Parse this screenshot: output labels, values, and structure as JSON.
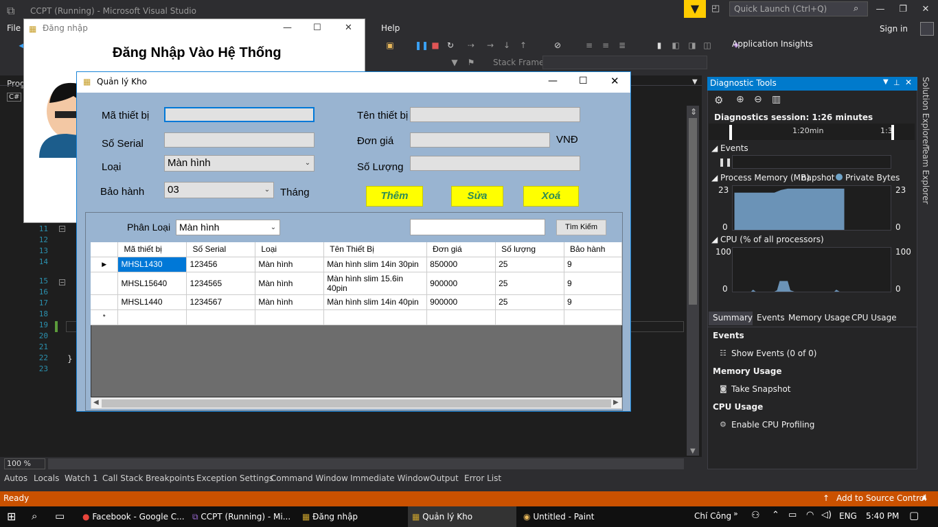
{
  "vs": {
    "title": "CCPT (Running) - Microsoft Visual Studio",
    "quick_launch": "Quick Launch (Ctrl+Q)",
    "menu": [
      "File",
      "Help"
    ],
    "sign_in": "Sign in",
    "app_insights": "Application Insights",
    "stack_frame": "Stack Frame:",
    "editor_tab_1": "Prog",
    "editor_tab_2": "C#",
    "line_numbers": [
      "11",
      "12",
      "13",
      "14",
      "15",
      "16",
      "17",
      "18",
      "19",
      "20",
      "21",
      "22",
      "23"
    ],
    "zoom": "100 %",
    "bottom_tabs": [
      "Autos",
      "Locals",
      "Watch 1",
      "Call Stack",
      "Breakpoints",
      "Exception Settings",
      "Command Window",
      "Immediate Window",
      "Output",
      "Error List"
    ],
    "status_ready": "Ready",
    "status_source": "Add to Source Control"
  },
  "diag": {
    "title": "Diagnostic Tools",
    "session": "Diagnostics session: 1:26 minutes",
    "timeline_label_1": "1:20min",
    "timeline_label_2": "1:3",
    "events_label": "Events",
    "memory_label": "Process Memory (MB)",
    "snapshot_label": "napshot",
    "private_bytes": "Private Bytes",
    "mem_max_left": "23",
    "mem_max_right": "23",
    "mem_min_left": "0",
    "mem_min_right": "0",
    "cpu_label": "CPU (% of all processors)",
    "cpu_max_left": "100",
    "cpu_max_right": "100",
    "cpu_min_left": "0",
    "cpu_min_right": "0",
    "tabs": [
      "Summary",
      "Events",
      "Memory Usage",
      "CPU Usage"
    ],
    "sect_events": "Events",
    "show_events": "Show Events (0 of 0)",
    "sect_memory": "Memory Usage",
    "take_snapshot": "Take Snapshot",
    "sect_cpu": "CPU Usage",
    "enable_cpu": "Enable CPU Profiling",
    "side_tab_1": "Solution Explorer",
    "side_tab_2": "Team Explorer"
  },
  "login": {
    "title": "Đăng nhập",
    "heading": "Đăng Nhập Vào Hệ Thống"
  },
  "qlk": {
    "title": "Quản lý Kho",
    "ma_thiet_bi_label": "Mã thiết bị",
    "so_serial_label": "Số Serial",
    "loai_label": "Loại",
    "loai_value": "Màn hình",
    "bao_hanh_label": "Bảo hành",
    "bao_hanh_value": "03",
    "thang_label": "Tháng",
    "ten_thiet_bi_label": "Tên thiết bị",
    "don_gia_label": "Đơn giá",
    "vnd_label": "VNĐ",
    "so_luong_label": "Số Lượng",
    "btn_them": "Thêm",
    "btn_sua": "Sửa",
    "btn_xoa": "Xoá",
    "phan_loai_label": "Phân Loại",
    "phan_loai_value": "Màn hình",
    "btn_tim_kiem": "Tìm Kiếm",
    "grid_headers": [
      "Mã thiết bị",
      "Số Serial",
      "Loại",
      "Tên Thiết Bị",
      "Đơn giá",
      "Số lượng",
      "Bảo hành"
    ],
    "grid_rows": [
      [
        "MHSL1430",
        "123456",
        "Màn hình",
        "Màn hình slim 14in 30pin",
        "850000",
        "25",
        "9"
      ],
      [
        "MHSL15640",
        "1234565",
        "Màn hình",
        "Màn hình slim 15.6in 40pin",
        "900000",
        "25",
        "9"
      ],
      [
        "MHSL1440",
        "1234567",
        "Màn hình",
        "Màn hình slim 14in 40pin",
        "900000",
        "25",
        "9"
      ]
    ]
  },
  "taskbar": {
    "items": [
      "Facebook - Google C...",
      "CCPT (Running) - Mi...",
      "Đăng nhập",
      "Quản lý Kho",
      "Untitled - Paint"
    ],
    "user": "Chí Công",
    "lang": "ENG",
    "time": "5:40 PM"
  }
}
